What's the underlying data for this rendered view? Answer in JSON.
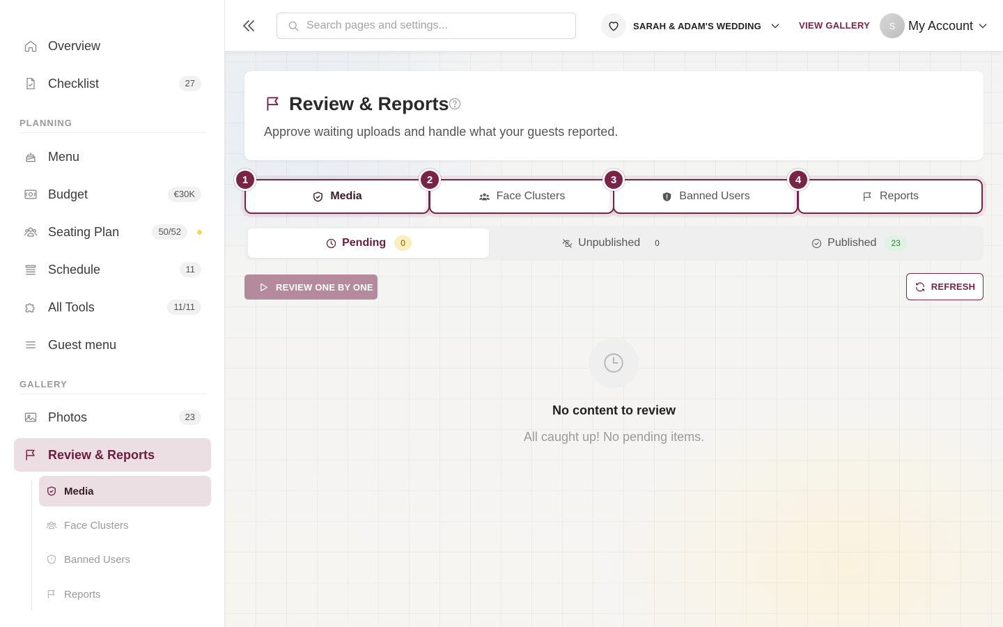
{
  "sidebar": {
    "items_top": [
      {
        "label": "Overview",
        "icon": "home-icon"
      },
      {
        "label": "Checklist",
        "icon": "checklist-icon",
        "badge": "27"
      }
    ],
    "planning_label": "PLANNING",
    "planning_items": [
      {
        "label": "Menu",
        "icon": "cake-icon"
      },
      {
        "label": "Budget",
        "icon": "money-icon",
        "badge": "€30K"
      },
      {
        "label": "Seating Plan",
        "icon": "people-icon",
        "badge": "50/52"
      },
      {
        "label": "Schedule",
        "icon": "list-icon",
        "badge": "11"
      },
      {
        "label": "All Tools",
        "icon": "puzzle-icon",
        "badge": "11/11"
      },
      {
        "label": "Guest menu",
        "icon": "hamburger-icon"
      }
    ],
    "gallery_label": "GALLERY",
    "gallery_items": [
      {
        "label": "Photos",
        "icon": "image-icon",
        "badge": "23"
      },
      {
        "label": "Review & Reports",
        "icon": "flag-icon"
      }
    ],
    "sub_items": [
      {
        "label": "Media",
        "icon": "shield-check-icon"
      },
      {
        "label": "Face Clusters",
        "icon": "people-icon"
      },
      {
        "label": "Banned Users",
        "icon": "shield-icon"
      },
      {
        "label": "Reports",
        "icon": "flag-icon"
      }
    ],
    "colors": {
      "accent": "#7b2347",
      "active_bg": "#ecdfe4",
      "dot": "#f5d94a"
    }
  },
  "topbar": {
    "search_placeholder": "Search pages and settings...",
    "search_value": "",
    "event_name": "SARAH & ADAM'S WEDDING",
    "view_gallery": "VIEW GALLERY",
    "avatar_initial": "S",
    "account_label": "My Account"
  },
  "header": {
    "title": "Review & Reports",
    "subtitle": "Approve waiting uploads and handle what your guests reported."
  },
  "steps": [
    {
      "num": "1",
      "label": "Media",
      "icon": "shield-check-icon"
    },
    {
      "num": "2",
      "label": "Face Clusters",
      "icon": "people-icon"
    },
    {
      "num": "3",
      "label": "Banned Users",
      "icon": "shield-icon"
    },
    {
      "num": "4",
      "label": "Reports",
      "icon": "flag-icon"
    }
  ],
  "status_tabs": [
    {
      "label": "Pending",
      "count": "0",
      "icon": "clock-icon"
    },
    {
      "label": "Unpublished",
      "count": "0",
      "icon": "eye-off-icon"
    },
    {
      "label": "Published",
      "count": "23",
      "icon": "check-circle-icon"
    }
  ],
  "actions": {
    "review_one_by_one": "REVIEW ONE BY ONE",
    "refresh": "REFRESH"
  },
  "empty_state": {
    "title": "No content to review",
    "subtitle": "All caught up! No pending items.",
    "icon": "clock-icon"
  }
}
